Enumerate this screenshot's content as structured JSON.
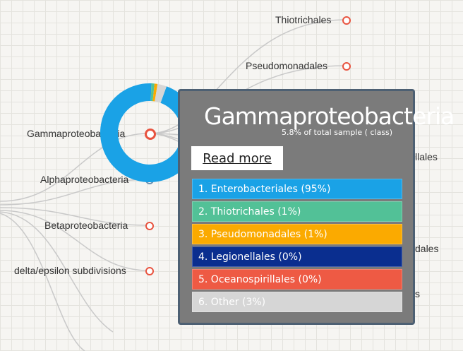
{
  "tree": {
    "nodes": [
      {
        "label": "Thiotrichales",
        "icon": "node-circle-icon"
      },
      {
        "label": "Pseudomonadales",
        "icon": "node-circle-icon"
      },
      {
        "label": "Gammaproteobacteria",
        "icon": "node-circle-icon"
      },
      {
        "label": "Alphaproteobacteria",
        "icon": "node-circle-icon"
      },
      {
        "label": "Betaproteobacteria",
        "icon": "node-circle-icon"
      },
      {
        "label": "delta/epsilon subdivisions",
        "icon": "node-circle-icon"
      }
    ],
    "partial_labels": [
      "llales",
      "dales",
      "s"
    ]
  },
  "popup": {
    "title": "Gammaproteobacteria",
    "subtitle": "5.8% of total sample ( class)",
    "read_more_label": "Read more",
    "legend": [
      {
        "label": "1. Enterobacteriales (95%)",
        "value": 95,
        "color": "#1aa2e6"
      },
      {
        "label": "2. Thiotrichales (1%)",
        "value": 1,
        "color": "#52c197"
      },
      {
        "label": "3. Pseudomonadales (1%)",
        "value": 1,
        "color": "#fbaa00"
      },
      {
        "label": "4. Legionellales (0%)",
        "value": 0,
        "color": "#0a2e8f"
      },
      {
        "label": "5. Oceanospirillales (0%)",
        "value": 0,
        "color": "#ee5a44"
      },
      {
        "label": "6. Other (3%)",
        "value": 3,
        "color": "#d6d6d6"
      }
    ]
  },
  "colors": {
    "node_ring": "#e8533f",
    "popup_bg": "#7b7b7b",
    "popup_border": "#4d6073",
    "link": "#c8c8c8"
  }
}
